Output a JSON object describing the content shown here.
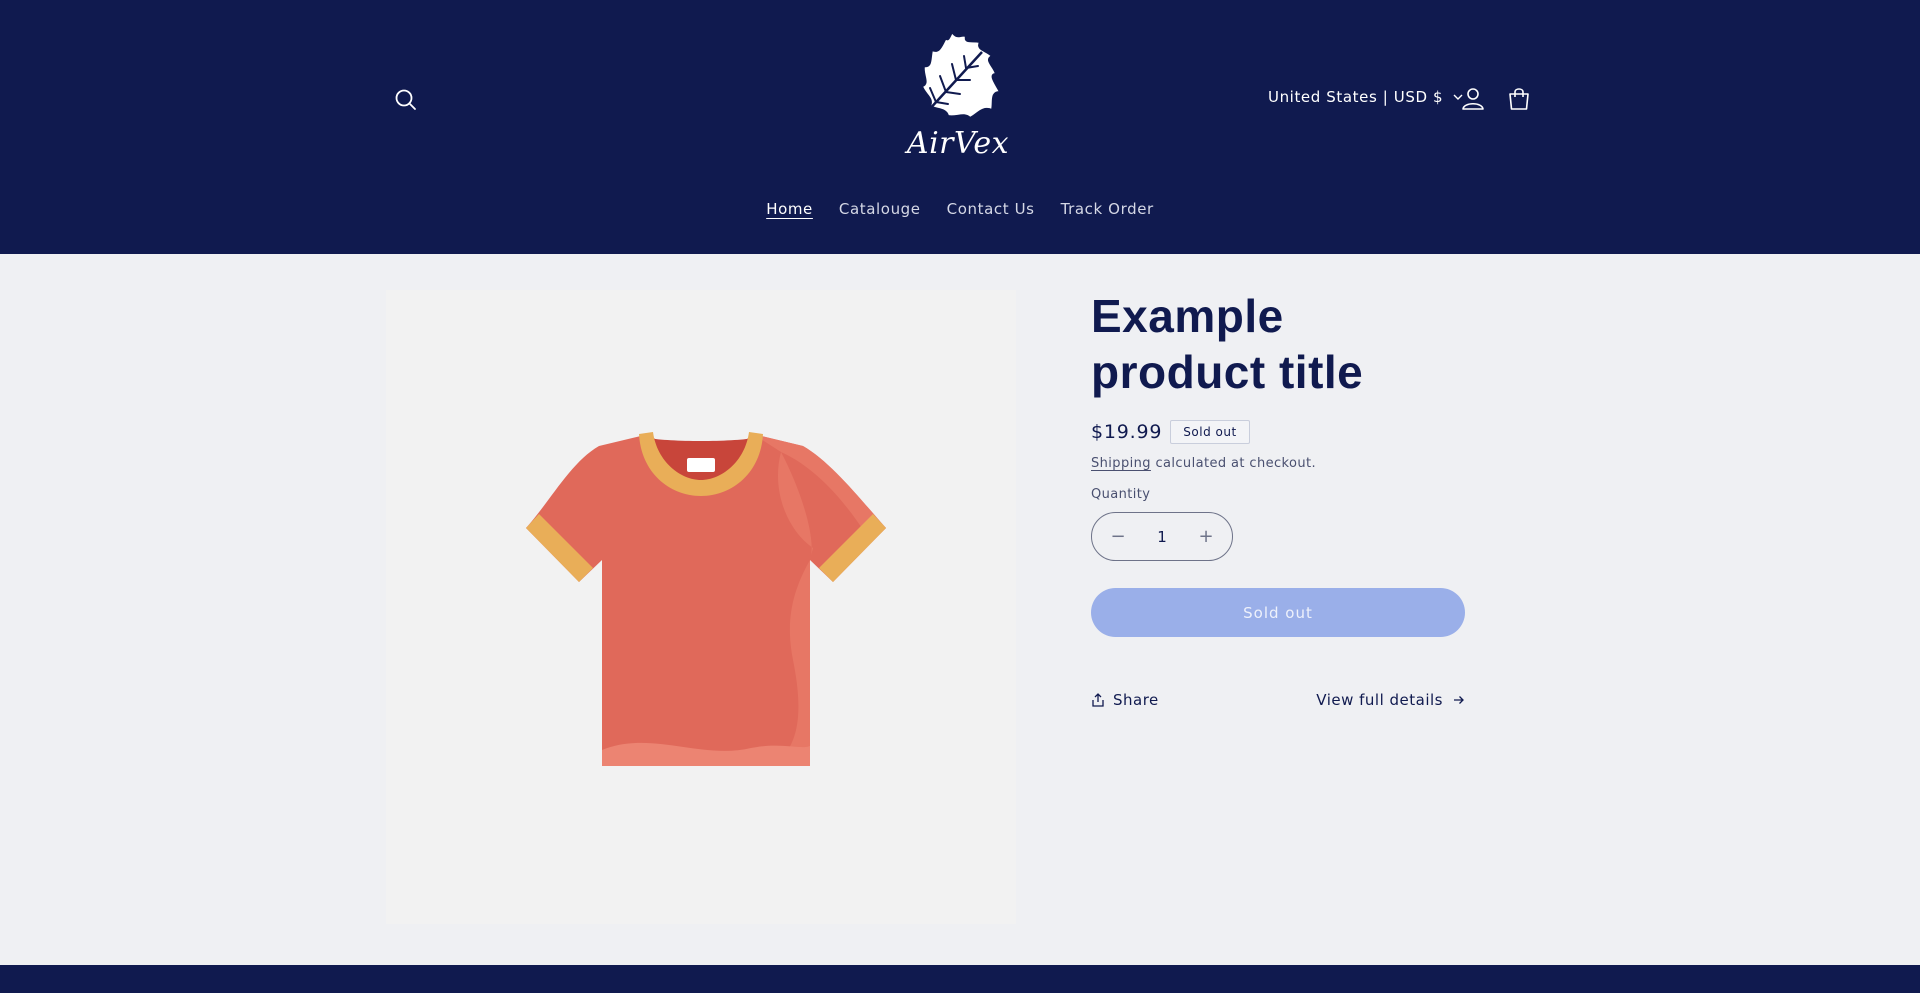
{
  "header": {
    "logo_text": "AirVex",
    "region_label": "United States | USD $",
    "icons": {
      "search": "search-icon",
      "account": "user-icon",
      "cart": "cart-icon",
      "region_chevron": "chevron-down-icon"
    }
  },
  "nav": {
    "items": [
      {
        "label": "Home",
        "active": true
      },
      {
        "label": "Catalouge",
        "active": false
      },
      {
        "label": "Contact Us",
        "active": false
      },
      {
        "label": "Track Order",
        "active": false
      }
    ]
  },
  "product": {
    "title": "Example product title",
    "price": "$19.99",
    "badge": "Sold out",
    "shipping_link": "Shipping",
    "shipping_text": " calculated at checkout.",
    "quantity_label": "Quantity",
    "quantity_value": "1",
    "decrease_symbol": "−",
    "increase_symbol": "+",
    "add_button_label": "Sold out",
    "share_label": "Share",
    "view_details_label": "View full details",
    "image": "t-shirt-image"
  },
  "colors": {
    "brand_navy": "#101a4f",
    "page_bg": "#eff0f3",
    "button_disabled": "#9aafe9",
    "shirt_body": "#e0695a",
    "shirt_trim": "#e9ae58"
  }
}
